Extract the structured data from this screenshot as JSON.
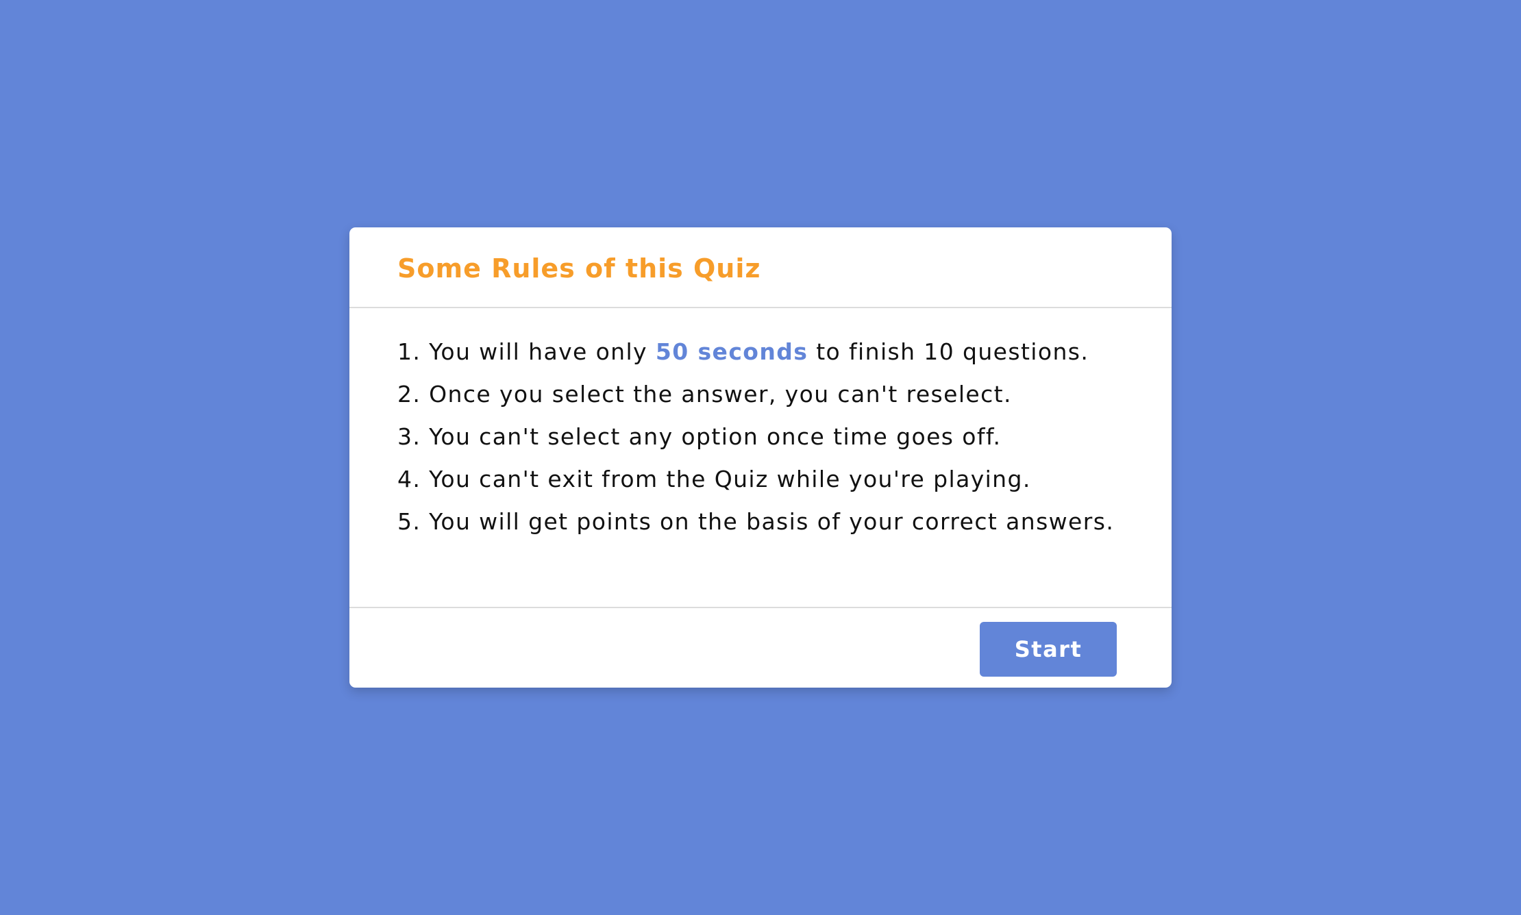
{
  "colors": {
    "background": "#6285d8",
    "card": "#ffffff",
    "title": "#f79d2a",
    "accent": "#6285d8",
    "divider": "#dcdcdc",
    "text": "#111111"
  },
  "header": {
    "title": "Some Rules of this Quiz"
  },
  "rules": [
    {
      "prefix": "1. You will have only ",
      "highlight": "50 seconds",
      "suffix": " to finish 10 questions."
    },
    {
      "text": "2. Once you select the answer, you can't reselect."
    },
    {
      "text": "3. You can't select any option once time goes off."
    },
    {
      "text": "4. You can't exit from the Quiz while you're playing."
    },
    {
      "text": "5. You will get points on the basis of your correct answers."
    }
  ],
  "footer": {
    "start_label": "Start"
  }
}
